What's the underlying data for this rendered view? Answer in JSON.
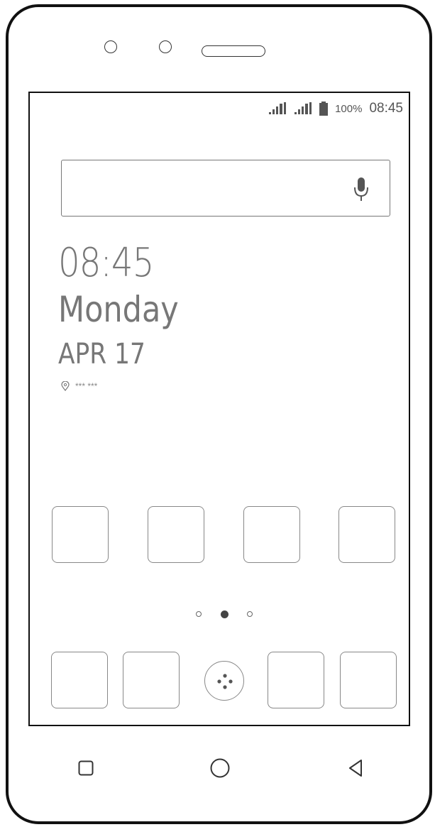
{
  "status_bar": {
    "battery_percent": "100%",
    "time": "08:45"
  },
  "search_bar": {
    "placeholder": "",
    "icon": "mic-icon"
  },
  "clock_widget": {
    "time": "08:45",
    "weekday": "Monday",
    "date": "APR 17",
    "location": "***  ***",
    "location_icon": "location-pin-icon"
  },
  "home_screen": {
    "app_row_count": 4,
    "page_indicator": {
      "pages": 3,
      "active_page": 2
    }
  },
  "dock": {
    "app_count": 4,
    "drawer_icon": "app-drawer-icon"
  },
  "nav_bar": {
    "recents_icon": "recents-square-icon",
    "home_icon": "home-circle-icon",
    "back_icon": "back-triangle-icon"
  }
}
